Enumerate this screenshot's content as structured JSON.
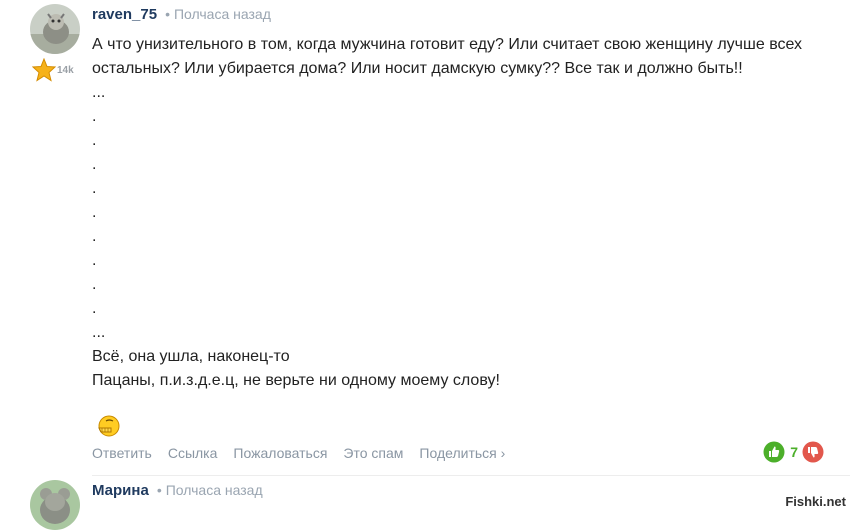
{
  "comments": [
    {
      "author": "raven_75",
      "time": "Полчаса назад",
      "rank_score": "14k",
      "lines": [
        "А что унизительного в том, когда мужчина готовит еду? Или считает свою женщину лучше всех остальных? Или убирается дома? Или носит дамскую сумку?? Все так и должно быть!!",
        "...",
        ".",
        ".",
        ".",
        ".",
        ".",
        ".",
        ".",
        ".",
        ".",
        "...",
        "Всё, она ушла, наконец-то",
        "Пацаны, п.и.з.д.е.ц, не верьте ни одному моему слову!"
      ],
      "emoji_icon": "facepalm-smiley-icon",
      "actions": [
        "Ответить",
        "Ссылка",
        "Пожаловаться",
        "Это спам",
        "Поделиться ›"
      ],
      "vote_count": "7"
    },
    {
      "author": "Марина",
      "time": "Полчаса назад"
    }
  ],
  "watermark": "Fishki.net",
  "colors": {
    "author": "#1f3a5f",
    "meta": "#9aa5b1",
    "vote_up": "#4caf2a",
    "vote_down": "#e2574c",
    "rank_star": "#f6b21a"
  }
}
